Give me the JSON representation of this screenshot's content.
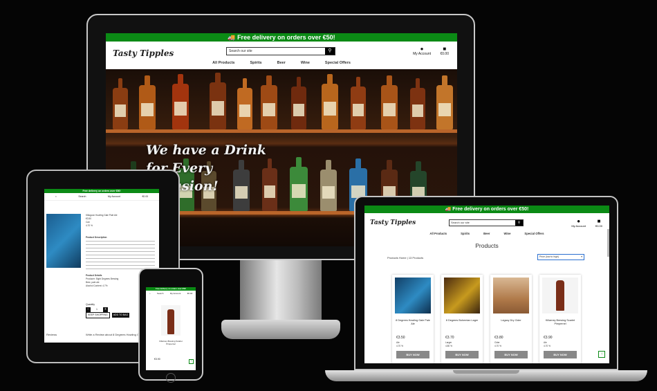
{
  "promo_banner": "Free delivery on orders over €50!",
  "brand": "Tasty Tipples",
  "search_placeholder": "Search our site",
  "account_label": "My Account",
  "bag_total": "€0.00",
  "nav": [
    "All Products",
    "Spirits",
    "Beer",
    "Wine",
    "Special Offers"
  ],
  "hero_text": "We have a Drink for Every Occasion!",
  "colors": {
    "accent": "#0b8a15",
    "background": "#000000"
  },
  "tablet": {
    "search_label": "Search",
    "account_label": "My Account",
    "bag_total": "€0.00",
    "product_name": "Killagoon Howling Gale Pale Ale",
    "price": "€3.50",
    "size": "Can",
    "abv": "4.70 %",
    "description_heading": "Product Description",
    "details_heading": "Product Details",
    "producer": "Producer: Eight Degrees Brewing",
    "category": "Beer, pale ale",
    "alcohol": "Alcohol Content: 4.7%",
    "quantity_label": "Quantity",
    "quantity_value": "1",
    "keep_shopping": "KEEP SHOPPING",
    "add_to_bag": "ADD TO BAG",
    "reviews_label": "Reviews",
    "write_review": "Write a Review about 8 Degrees Howling Gale Pale Ale"
  },
  "phone": {
    "search_label": "Search",
    "account_label": "My Account",
    "bag_total": "€0.00",
    "product_name": "Killarney Brewing Scarlet Pimpernel",
    "price": "€3.90"
  },
  "laptop": {
    "page_title": "Products",
    "breadcrumb": "Products Home | 13 Products",
    "sort_label": "Price (low to high)",
    "products": [
      {
        "name": "8 Degrees Howling Gale Pale Ale",
        "price": "€3.50",
        "type": "Ale",
        "abv": "4.70 %",
        "buy": "BUY NOW",
        "color": "#1f6ea8"
      },
      {
        "name": "8 Degrees Bohemian Lager",
        "price": "€3.70",
        "type": "Larger",
        "abv": "4.80 %",
        "buy": "BUY NOW",
        "color": "#c79a1e"
      },
      {
        "name": "Legacy Dry Cider",
        "price": "€3.80",
        "type": "Cider",
        "abv": "4.70 %",
        "buy": "BUY NOW",
        "color": "#9a6a3c"
      },
      {
        "name": "Killarney Brewing Scarlet Pimpernel",
        "price": "€3.90",
        "type": "Ale",
        "abv": "4.70 %",
        "buy": "BUY NOW",
        "color": "#7a2e18"
      }
    ]
  }
}
